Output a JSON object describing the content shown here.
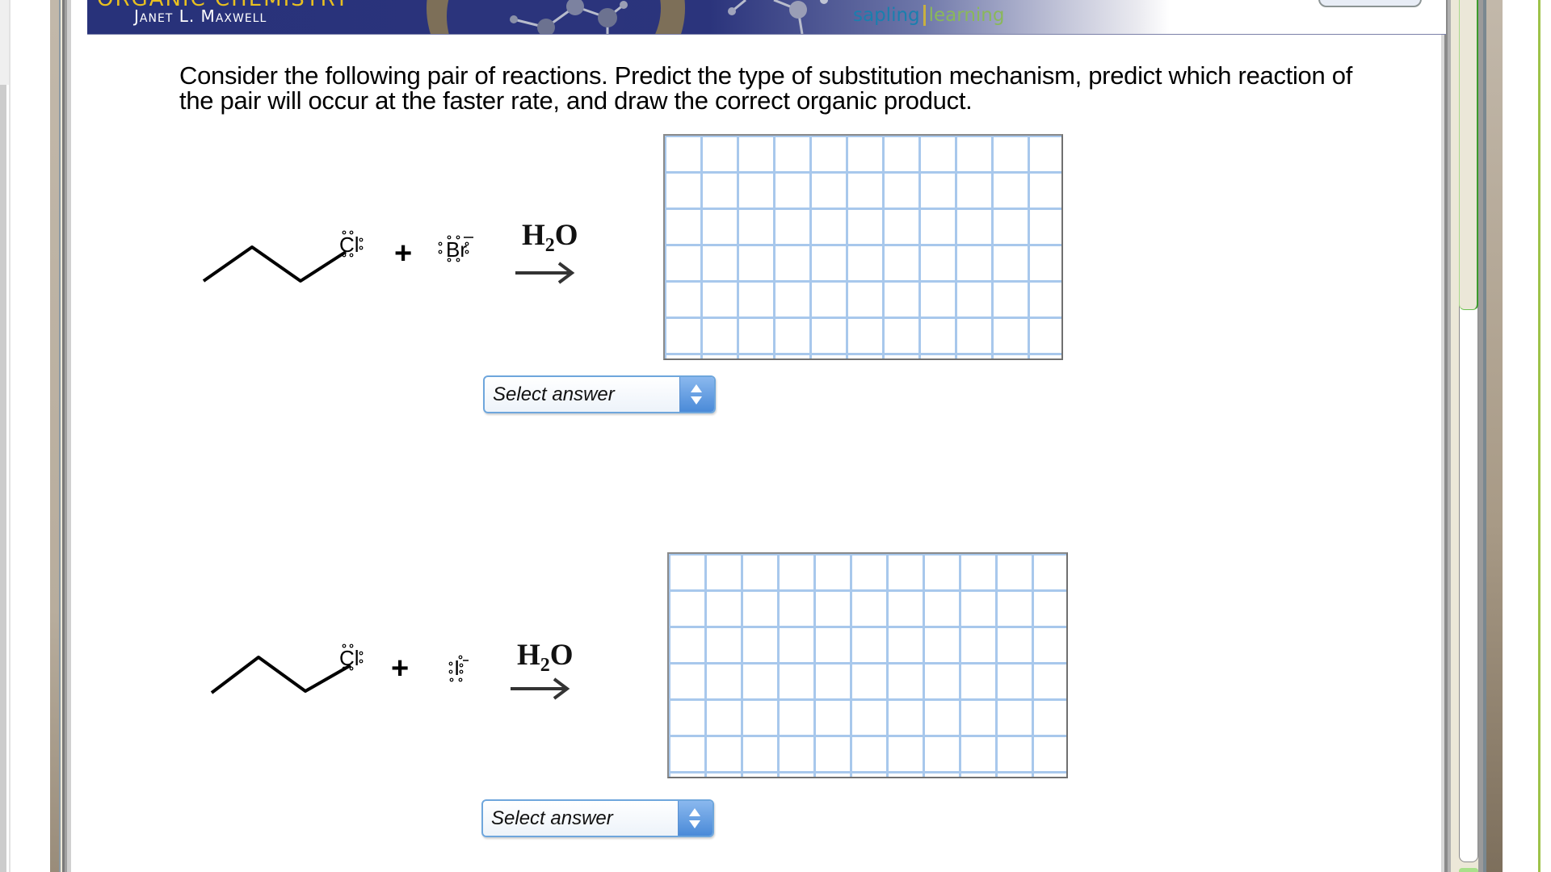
{
  "header": {
    "book_title": "ORGANIC CHEMISTRY",
    "author": "Janet L. Maxwell",
    "brand_left": "sapling",
    "brand_right": "learning",
    "brand_colors": {
      "sapling": "#1a7fae",
      "learning": "#8ab85a"
    }
  },
  "question": {
    "text": "Consider the following pair of reactions. Predict the type of substitution mechanism, predict which reaction of the pair will occur at the faster rate, and draw the correct organic product."
  },
  "reactions": [
    {
      "substrate_leaving_group": "Cl",
      "plus": "+",
      "nucleophile": "Br",
      "nucleophile_charge": "−",
      "solvent_main": "H",
      "solvent_sub": "2",
      "solvent_end": "O",
      "answer_select": {
        "selected": "Select answer"
      }
    },
    {
      "substrate_leaving_group": "Cl",
      "plus": "+",
      "nucleophile": "I",
      "nucleophile_charge": "−",
      "solvent_main": "H",
      "solvent_sub": "2",
      "solvent_end": "O",
      "answer_select": {
        "selected": "Select answer"
      }
    }
  ],
  "icons": {
    "select_arrows": "updown-arrows-icon",
    "reaction_arrow": "right-arrow-icon"
  }
}
